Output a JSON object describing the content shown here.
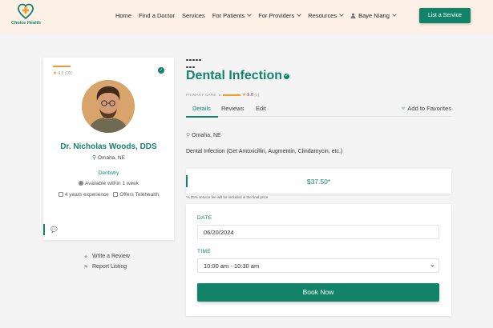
{
  "brand": {
    "name": "Choice Health"
  },
  "nav": {
    "items": [
      {
        "label": "Home",
        "has_dropdown": false
      },
      {
        "label": "Find a Doctor",
        "has_dropdown": false
      },
      {
        "label": "Services",
        "has_dropdown": false
      },
      {
        "label": "For Patients",
        "has_dropdown": true
      },
      {
        "label": "For Providers",
        "has_dropdown": true
      },
      {
        "label": "Resources",
        "has_dropdown": true
      }
    ],
    "user": "Baye Niang",
    "cta": "List a Service"
  },
  "provider": {
    "rating_small": "4.2 (10)",
    "name": "Dr. Nicholas Woods, DDS",
    "location": "Omaha, NE",
    "specialty": "Dentistry",
    "availability": "Available within 1 week",
    "experience": "4 years experience",
    "telehealth": "Offers Telehealth"
  },
  "side_links": {
    "review": "Write a Review",
    "report": "Report Listing"
  },
  "service": {
    "title": "Dental Infection",
    "category": "PRIMARY CARE",
    "rating": "5.0",
    "rating_count": "(2)",
    "tabs": [
      "Details",
      "Reviews",
      "Edit"
    ],
    "favorites": "Add to Favorites",
    "location": "Omaha, NE",
    "description": "Dental Infection (Get Amoxicillin, Augmentin, Clindamycin, etc.)",
    "price": "$37.50*",
    "fee_note": "*A 25% service fee will be included in the final price"
  },
  "booking": {
    "date_label": "DATE",
    "date_value": "06/20/2024",
    "time_label": "TIME",
    "time_value": "10:00 am - 10:30 am",
    "submit": "Book Now"
  },
  "colors": {
    "brand": "#128268",
    "star": "#f29a2e",
    "header_bg": "#fdf0e6"
  }
}
